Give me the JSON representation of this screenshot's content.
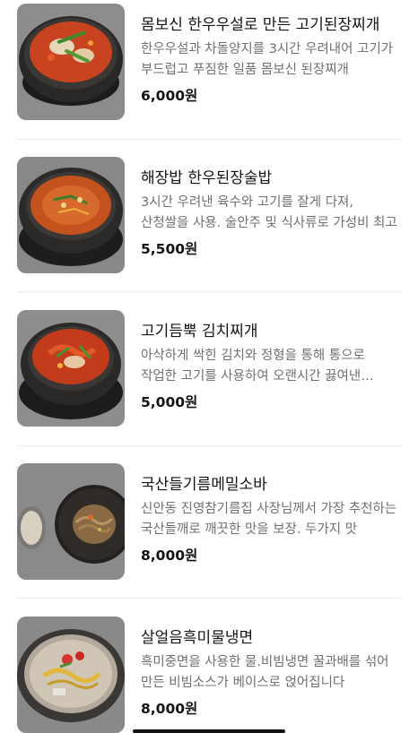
{
  "menu": {
    "items": [
      {
        "name": "몸보신 한우우설로 만든 고기된장찌개",
        "description": "한우우설과 차돌양지를 3시간 우려내어 고기가 부드럽고 푸짐한 일품 몸보신 된장찌개",
        "price": "6,000원",
        "image_icon": "doenjang-jjigae-photo"
      },
      {
        "name": "해장밥 한우된장술밥",
        "description": "3시간 우려낸 육수와 고기를 잘게 다져, 산청쌀을 사용. 술안주 및 식사류로 가성비 최고",
        "price": "5,500원",
        "image_icon": "doenjang-sulbap-photo"
      },
      {
        "name": "고기듬뿍 김치찌개",
        "description": "아삭하게 싹힌 김치와 정형을 통해 통으로 작업한 고기를 사용하여 오랜시간 끓여낸 김치찌개",
        "price": "5,000원",
        "image_icon": "kimchi-jjigae-photo"
      },
      {
        "name": "국산들기름메밀소바",
        "description": "신안동 진영참기름집 사장님께서 가장 추천하는 국산들깨로 깨끗한 맛을 보장. 두가지 맛",
        "price": "8,000원",
        "image_icon": "perilla-soba-photo"
      },
      {
        "name": "살얼음흑미물냉면",
        "description": "흑미중면을 사용한 물.비빔냉면 꿀과배를 섞어 만든 비빔소스가 베이스로 얹어집니다",
        "price": "8,000원",
        "image_icon": "naengmyeon-photo"
      }
    ]
  },
  "colors": {
    "title": "#141414",
    "description": "#707070",
    "divider": "#ececec"
  }
}
